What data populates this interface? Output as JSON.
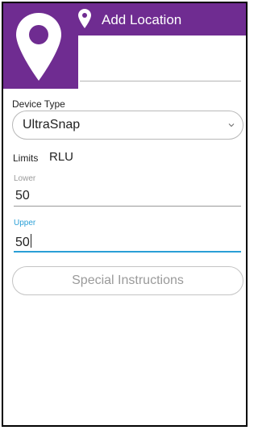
{
  "header": {
    "title": "Add Location",
    "color": "#6f2c91",
    "icon": "map-pin-icon"
  },
  "logo": {
    "icon": "map-pin-icon",
    "color": "#6f2c91"
  },
  "form": {
    "location_name": {
      "value": ""
    },
    "device_type": {
      "label": "Device Type",
      "selected": "UltraSnap",
      "icon": "chevron-down-icon"
    },
    "limits": {
      "label": "Limits",
      "unit": "RLU",
      "lower": {
        "label": "Lower",
        "value": "50"
      },
      "upper": {
        "label": "Upper",
        "value": "50"
      }
    },
    "special_instructions_label": "Special Instructions",
    "focus_color": "#2a9fd6"
  }
}
